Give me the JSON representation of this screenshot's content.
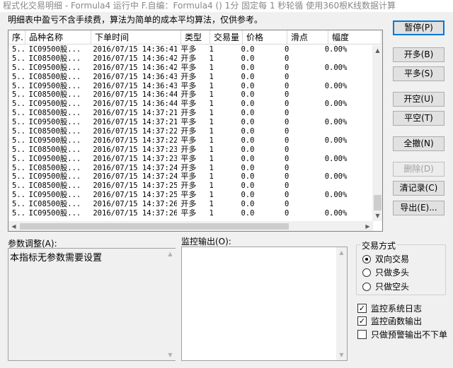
{
  "window": {
    "title": "程式化交易明细 - Formula4 运行中  F.自编：Formula4 () 1分 固定每 1 秒轮循 使用360根K线数据计算"
  },
  "notice": "明细表中盈亏不含手续费，算法为简单的成本平均算法，仅供参考。",
  "table": {
    "headers": [
      "序.",
      "品种名称",
      "下单时间",
      "类型",
      "交易量",
      "价格",
      "滑点",
      "幅度"
    ],
    "rows": [
      [
        "5..",
        "IC09500股...",
        "2016/07/15 14:36:41",
        "平多",
        "1",
        "0.0",
        "0",
        "0.00%"
      ],
      [
        "5..",
        "IC08500股...",
        "2016/07/15 14:36:42",
        "开多",
        "1",
        "0.0",
        "0",
        ""
      ],
      [
        "5..",
        "IC09500股...",
        "2016/07/15 14:36:42",
        "平多",
        "1",
        "0.0",
        "0",
        "0.00%"
      ],
      [
        "5..",
        "IC08500股...",
        "2016/07/15 14:36:43",
        "开多",
        "1",
        "0.0",
        "0",
        ""
      ],
      [
        "5..",
        "IC09500股...",
        "2016/07/15 14:36:43",
        "平多",
        "1",
        "0.0",
        "0",
        "0.00%"
      ],
      [
        "5..",
        "IC08500股...",
        "2016/07/15 14:36:44",
        "开多",
        "1",
        "0.0",
        "0",
        ""
      ],
      [
        "5..",
        "IC09500股...",
        "2016/07/15 14:36:44",
        "平多",
        "1",
        "0.0",
        "0",
        "0.00%"
      ],
      [
        "5..",
        "IC08500股...",
        "2016/07/15 14:37:21",
        "开多",
        "1",
        "0.0",
        "0",
        ""
      ],
      [
        "5..",
        "IC09500股...",
        "2016/07/15 14:37:21",
        "平多",
        "1",
        "0.0",
        "0",
        "0.00%"
      ],
      [
        "5..",
        "IC08500股...",
        "2016/07/15 14:37:22",
        "开多",
        "1",
        "0.0",
        "0",
        ""
      ],
      [
        "5..",
        "IC09500股...",
        "2016/07/15 14:37:22",
        "平多",
        "1",
        "0.0",
        "0",
        "0.00%"
      ],
      [
        "5..",
        "IC08500股...",
        "2016/07/15 14:37:23",
        "开多",
        "1",
        "0.0",
        "0",
        ""
      ],
      [
        "5..",
        "IC09500股...",
        "2016/07/15 14:37:23",
        "平多",
        "1",
        "0.0",
        "0",
        "0.00%"
      ],
      [
        "5..",
        "IC08500股...",
        "2016/07/15 14:37:24",
        "开多",
        "1",
        "0.0",
        "0",
        ""
      ],
      [
        "5..",
        "IC09500股...",
        "2016/07/15 14:37:24",
        "平多",
        "1",
        "0.0",
        "0",
        "0.00%"
      ],
      [
        "5..",
        "IC08500股...",
        "2016/07/15 14:37:25",
        "开多",
        "1",
        "0.0",
        "0",
        ""
      ],
      [
        "5..",
        "IC09500股...",
        "2016/07/15 14:37:25",
        "平多",
        "1",
        "0.0",
        "0",
        "0.00%"
      ],
      [
        "5..",
        "IC08500股...",
        "2016/07/15 14:37:26",
        "开多",
        "1",
        "0.0",
        "0",
        ""
      ],
      [
        "5..",
        "IC09500股...",
        "2016/07/15 14:37:26",
        "平多",
        "1",
        "0.0",
        "0",
        "0.00%"
      ]
    ]
  },
  "buttons": {
    "pause": "暂停(P)",
    "open_long": "开多(B)",
    "close_long": "平多(S)",
    "open_short": "开空(U)",
    "close_short": "平空(T)",
    "close_all": "全撤(N)",
    "delete": "删除(D)",
    "clear_log": "清记录(C)",
    "export": "导出(E)..."
  },
  "params": {
    "label": "参数调整(A):",
    "text": "本指标无参数需要设置"
  },
  "monitor": {
    "label": "监控输出(O):"
  },
  "trade_mode": {
    "label": "交易方式",
    "options": [
      "双向交易",
      "只做多头",
      "只做空头"
    ],
    "selected": 0
  },
  "checks": [
    {
      "label": "监控系统日志",
      "checked": true
    },
    {
      "label": "监控函数输出",
      "checked": true
    },
    {
      "label": "只做预警输出不下单",
      "checked": false
    }
  ]
}
